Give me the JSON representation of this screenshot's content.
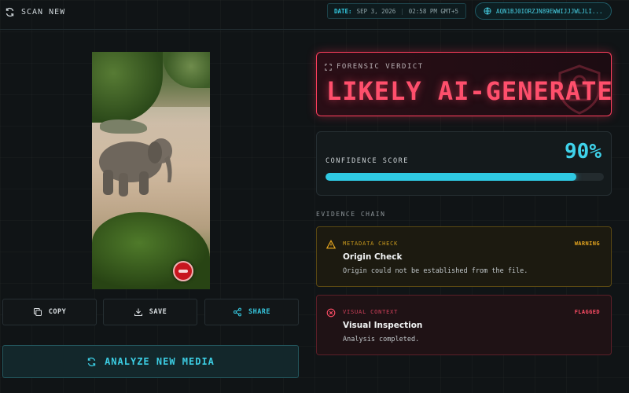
{
  "header": {
    "scan_new_label": "SCAN NEW",
    "date_key": "DATE:",
    "date_value": "SEP 3, 2026",
    "time_value": "02:58 PM GMT+5",
    "scan_id": "AQN1BJ0IORZJN89EWWIJJJWLJLI..."
  },
  "actions": {
    "copy_label": "COPY",
    "save_label": "SAVE",
    "share_label": "SHARE",
    "analyze_label": "ANALYZE NEW MEDIA"
  },
  "verdict": {
    "heading": "FORENSIC VERDICT",
    "result": "LIKELY AI-GENERATED"
  },
  "confidence": {
    "label": "CONFIDENCE SCORE",
    "value_text": "90%",
    "value": 0.9
  },
  "evidence": {
    "label": "EVIDENCE CHAIN",
    "items": [
      {
        "category": "METADATA CHECK",
        "status": "WARNING",
        "title": "Origin Check",
        "description": "Origin could not be established from the file.",
        "icon": "warning-triangle-icon"
      },
      {
        "category": "VISUAL CONTEXT",
        "status": "FLAGGED",
        "title": "Visual Inspection",
        "description": "Analysis completed.",
        "icon": "x-circle-icon"
      }
    ]
  },
  "colors": {
    "accent_cyan": "#2fc9e2",
    "alert_red": "#ff4f6c",
    "warning_amber": "#e2a31f",
    "background": "#101416"
  }
}
